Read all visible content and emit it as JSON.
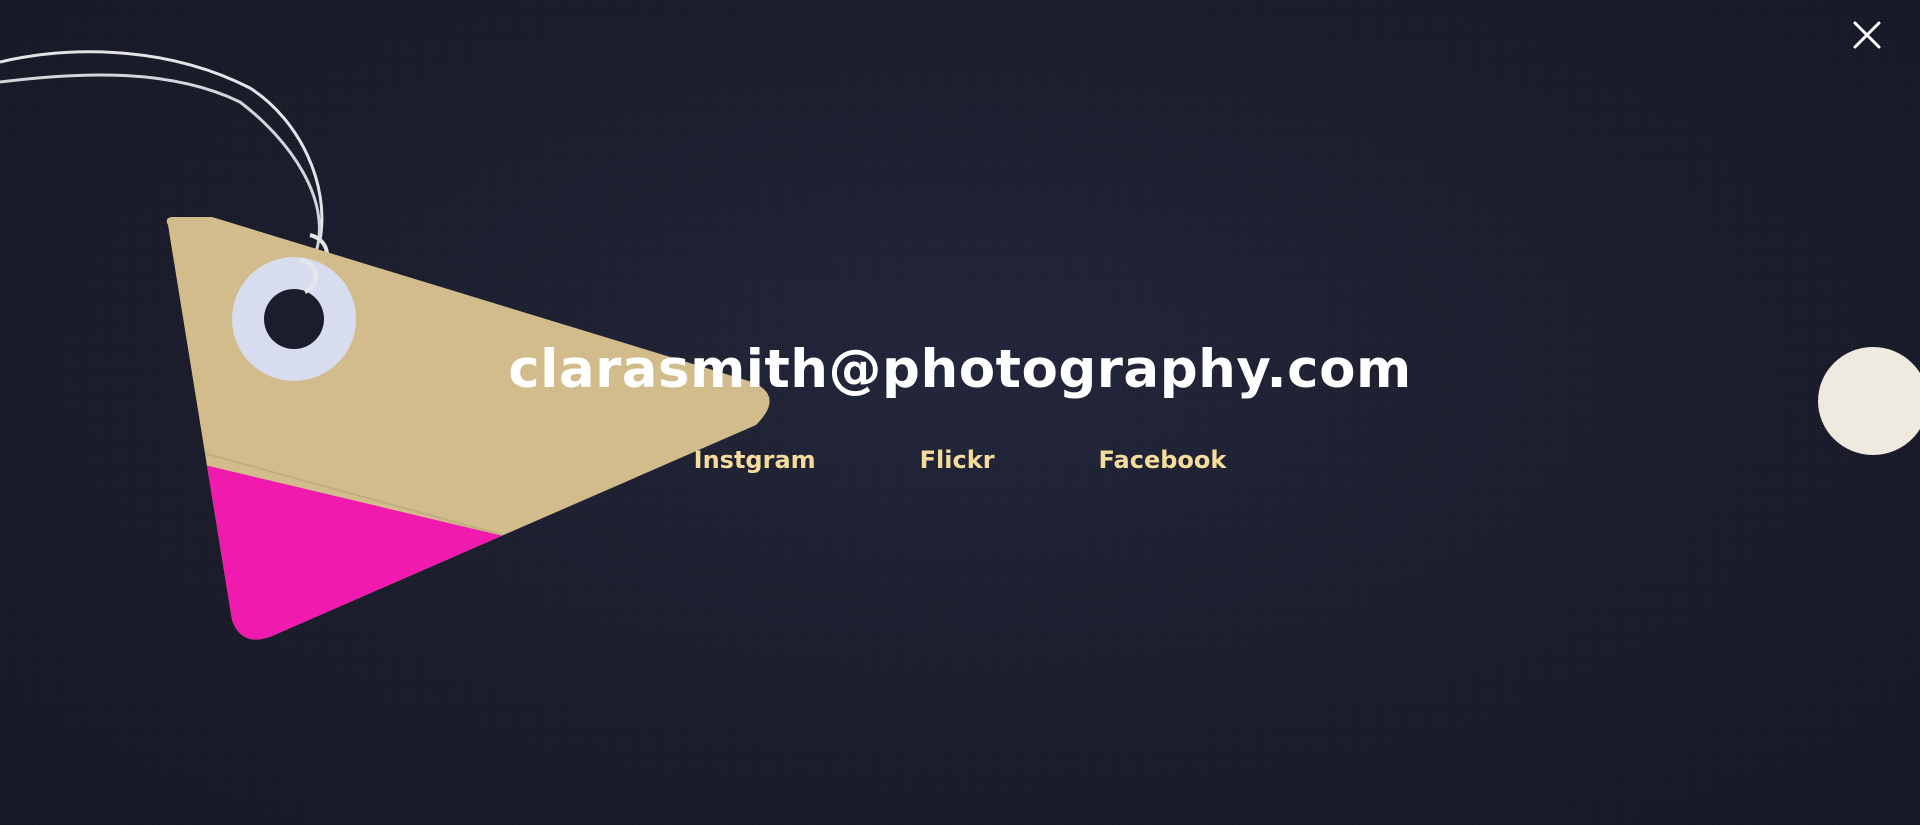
{
  "overlay": {
    "email": "clarasmith@photography.com",
    "close_icon": "close-icon"
  },
  "social_links": [
    {
      "label": "Instgram"
    },
    {
      "label": "Flickr"
    },
    {
      "label": "Facebook"
    }
  ],
  "colors": {
    "background": "#1c1e2e",
    "email_text": "#ffffff",
    "link_text": "#f3dc9c",
    "tag_kraft": "#d2bc8c",
    "tag_pink": "#f01aae",
    "side_circle": "#eeeadf"
  }
}
